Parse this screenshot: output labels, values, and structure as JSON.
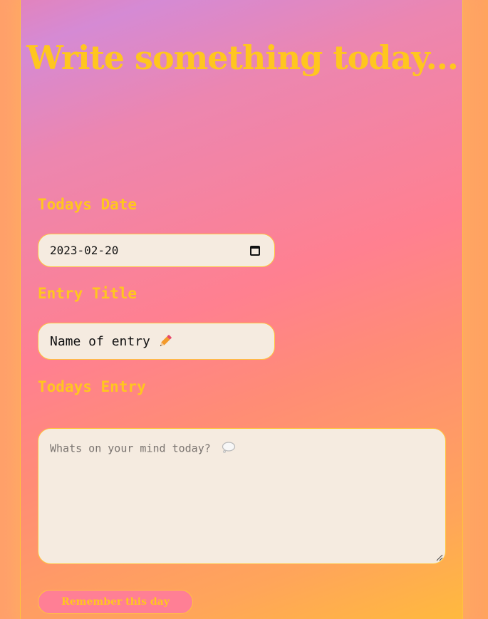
{
  "page": {
    "heading": "Write something today..."
  },
  "form": {
    "date_label": "Todays Date",
    "date_value": "2023-02-20",
    "title_label": "Entry Title",
    "title_value": "Name of entry",
    "title_emoji_icon": "pencil-icon",
    "entry_label": "Todays Entry",
    "entry_placeholder": "Whats on your mind today?",
    "entry_emoji_icon": "speech-bubble-icon",
    "submit_label": "Remember this day"
  },
  "colors": {
    "accent_yellow": "#ffc61f",
    "field_background": "#f5ebe0",
    "button_pink": "#ff7f95"
  }
}
